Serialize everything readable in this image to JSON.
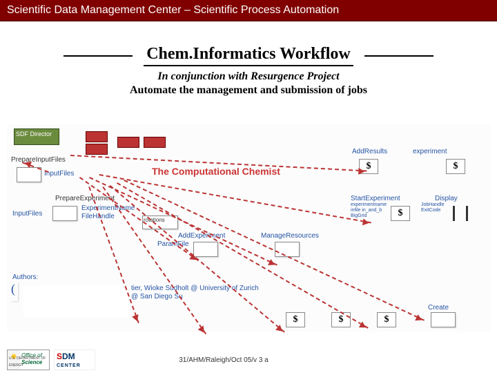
{
  "header": "Scientific Data Management Center – Scientific Process Automation",
  "title": "Chem.Informatics Workflow",
  "subtitle": "In conjunction with Resurgence Project",
  "description": "Automate the management and submission of jobs",
  "footnote": "31/AHM/Raleigh/Oct 05/v 3 a",
  "logos": {
    "science_label": "Office of",
    "science_label2": "Science",
    "science_sub": "U.S. DEPARTMENT OF ENERGY",
    "sdm": "SDM",
    "sdm_center": "CENTER"
  },
  "diagram": {
    "director": "SDF Director",
    "section_prepare": "PrepareInputFiles",
    "section_prepexp": "PrepareExperiment",
    "center_label": "The Computational Chemist",
    "labels": {
      "inputfiles": "InputFiles",
      "expname": "ExperimentName",
      "filehandle": "FileHandle",
      "rotations": "rotations",
      "addexp": "AddExperiment",
      "paramfile": "ParamFile",
      "manageres": "ManageResources",
      "addresults": "AddResults",
      "experiment": "experiment",
      "startexp": "StartExperiment",
      "startexp_sub": "experimentname\ninfile in_and_b\nBigGrid",
      "display": "Display",
      "display_sub": "JobHandle\nExitCode",
      "create": "Create",
      "authors": "Authors:"
    },
    "authors_frag": "tier, Wioke Sudholt @ University of Zurich\n@ San Diego Su"
  }
}
